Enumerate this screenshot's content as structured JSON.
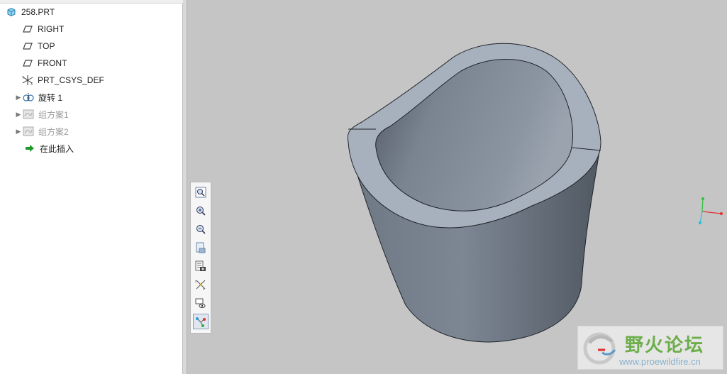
{
  "model_tree": {
    "items": [
      {
        "label": "258.PRT",
        "icon": "part-icon",
        "expandable": false,
        "disabled": false
      },
      {
        "label": "RIGHT",
        "icon": "datum-plane-icon",
        "expandable": false,
        "disabled": false
      },
      {
        "label": "TOP",
        "icon": "datum-plane-icon",
        "expandable": false,
        "disabled": false
      },
      {
        "label": "FRONT",
        "icon": "datum-plane-icon",
        "expandable": false,
        "disabled": false
      },
      {
        "label": "PRT_CSYS_DEF",
        "icon": "coordinate-system-icon",
        "expandable": false,
        "disabled": false
      },
      {
        "label": "旋转 1",
        "icon": "revolve-icon",
        "expandable": true,
        "disabled": false
      },
      {
        "label": "组方案1",
        "icon": "group-icon",
        "expandable": true,
        "disabled": true
      },
      {
        "label": "组方案2",
        "icon": "group-icon",
        "expandable": true,
        "disabled": true
      },
      {
        "label": "在此插入",
        "icon": "insert-here-arrow-icon",
        "expandable": false,
        "disabled": false
      }
    ]
  },
  "view_toolbar": {
    "buttons": [
      {
        "name": "refit-button",
        "icon": "refit-zoom-icon"
      },
      {
        "name": "zoom-in-button",
        "icon": "zoom-in-icon"
      },
      {
        "name": "zoom-out-button",
        "icon": "zoom-out-icon"
      },
      {
        "name": "repaint-button",
        "icon": "repaint-icon"
      },
      {
        "name": "saved-orientations-button",
        "icon": "saved-view-icon"
      },
      {
        "name": "datum-display-button",
        "icon": "datum-display-filter-icon"
      },
      {
        "name": "display-style-button",
        "icon": "display-style-icon"
      },
      {
        "name": "spin-center-button",
        "icon": "spin-center-icon",
        "active": true
      }
    ]
  },
  "watermark": {
    "title": "野火论坛",
    "url": "www.proewildfire.cn"
  },
  "colors": {
    "viewport_bg": "#c5c5c5",
    "model_surface": "#7c8693",
    "model_edge": "#1f2328",
    "csys_x": "#e03030",
    "csys_y": "#30c040",
    "csys_z": "#30c0d0"
  }
}
